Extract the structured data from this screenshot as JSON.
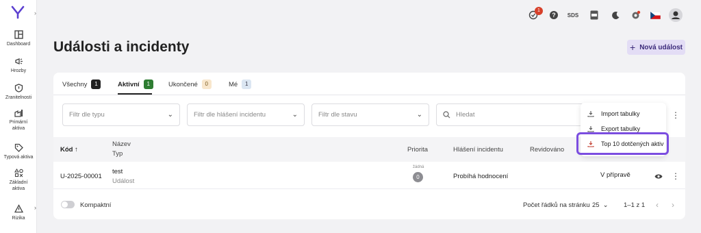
{
  "sidebar": {
    "items": [
      {
        "label": "Dashboard",
        "icon": "dashboard-icon"
      },
      {
        "label": "Hrozby",
        "icon": "megaphone-icon"
      },
      {
        "label": "Zranitelnosti",
        "icon": "shield-icon"
      },
      {
        "label": "Primární aktiva",
        "icon": "factory-icon"
      },
      {
        "label": "Typová aktiva",
        "icon": "tag-icon"
      },
      {
        "label": "Základní aktiva",
        "icon": "shapes-icon"
      },
      {
        "label": "Rizika",
        "icon": "warning-icon"
      }
    ]
  },
  "topbar": {
    "tasks_badge": "1",
    "sds_label": "SDS"
  },
  "page": {
    "title": "Události a incidenty",
    "new_button": "Nová událost"
  },
  "tabs": [
    {
      "label": "Všechny",
      "count": "1",
      "color": "#222222",
      "text_color": "#ffffff"
    },
    {
      "label": "Aktivní",
      "count": "1",
      "color": "#2e7d32",
      "text_color": "#ffffff"
    },
    {
      "label": "Ukončené",
      "count": "0",
      "color": "#f8e6cc",
      "text_color": "#7a5a20"
    },
    {
      "label": "Mé",
      "count": "1",
      "color": "#dbe6f2",
      "text_color": "#334"
    }
  ],
  "filters": {
    "type": "Filtr dle typu",
    "report": "Filtr dle hlášení incidentu",
    "state": "Filtr dle stavu",
    "search": "Hledat"
  },
  "table": {
    "headers": {
      "code": "Kód",
      "name": "Název",
      "type": "Typ",
      "priority": "Priorita",
      "report": "Hlášení incidentu",
      "reviewed": "Revidováno"
    },
    "rows": [
      {
        "code": "U-2025-00001",
        "name": "test",
        "type": "Událost",
        "priority_label": "žádná",
        "priority_value": "0",
        "report": "Probíhá hodnocení",
        "state": "V přípravě"
      }
    ]
  },
  "footer": {
    "compact_label": "Kompaktní",
    "rows_per_page_label": "Počet řádků na stránku",
    "rows_per_page": "25",
    "range": "1–1 z 1"
  },
  "menu": {
    "items": [
      "Import tabulky",
      "Export tabulky",
      "Top 10 dotčených aktiv"
    ]
  },
  "colors": {
    "accent": "#7b4de0",
    "primary_button_bg": "#e3ddf5"
  }
}
